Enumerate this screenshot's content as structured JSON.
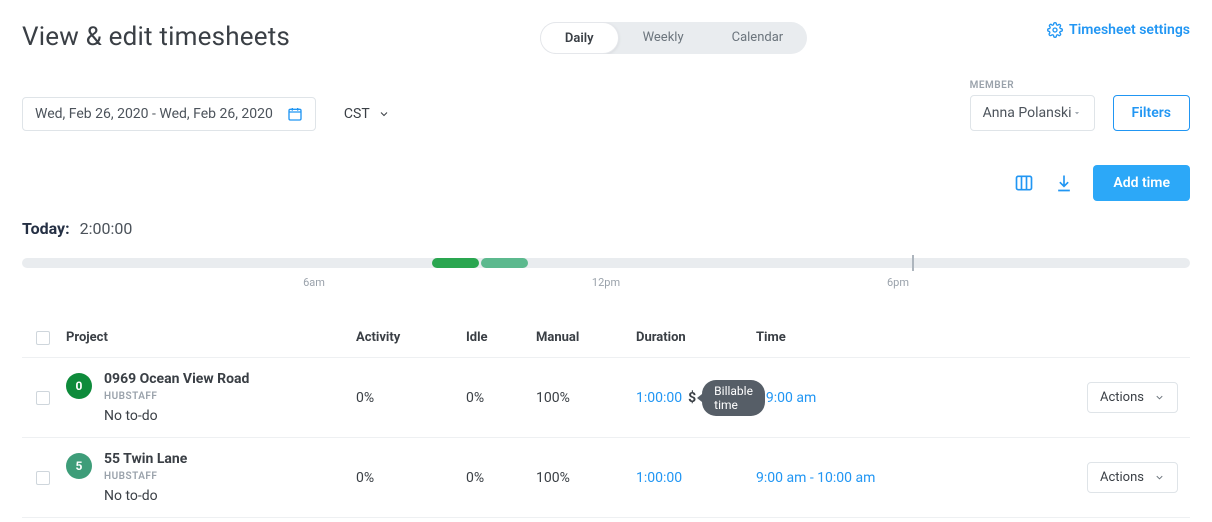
{
  "page_title": "View & edit timesheets",
  "view_tabs": {
    "daily": "Daily",
    "weekly": "Weekly",
    "calendar": "Calendar"
  },
  "settings_link": "Timesheet settings",
  "date_range": "Wed, Feb 26, 2020 - Wed, Feb 26, 2020",
  "timezone": "CST",
  "member_label": "MEMBER",
  "member_value": "Anna Polanski",
  "filters_label": "Filters",
  "add_time_label": "Add time",
  "today_label": "Today:",
  "today_value": "2:00:00",
  "timeline": {
    "ticks": [
      {
        "label": "6am",
        "pct": 25
      },
      {
        "label": "12pm",
        "pct": 50
      },
      {
        "label": "6pm",
        "pct": 75
      }
    ],
    "now_marker_pct": 76.2,
    "segments": [
      {
        "left_pct": 35.1,
        "width_pct": 4.0,
        "color": "#2aa650"
      },
      {
        "left_pct": 39.3,
        "width_pct": 4.0,
        "color": "#5cb98e"
      }
    ]
  },
  "columns": {
    "project": "Project",
    "activity": "Activity",
    "idle": "Idle",
    "manual": "Manual",
    "duration": "Duration",
    "time": "Time"
  },
  "tooltip_billable": "Billable time",
  "actions_label": "Actions",
  "rows": [
    {
      "badge_text": "0",
      "badge_color": "#0e8b3b",
      "name": "0969 Ocean View Road",
      "org": "HUBSTAFF",
      "todo": "No to-do",
      "activity": "0%",
      "idle": "0%",
      "manual": "100%",
      "duration": "1:00:00",
      "show_dollar": true,
      "show_tooltip": true,
      "time_overlapped": "00 am - 9:00 am",
      "time": "8:00 am - 9:00 am"
    },
    {
      "badge_text": "5",
      "badge_color": "#3e9d79",
      "name": "55 Twin Lane",
      "org": "HUBSTAFF",
      "todo": "No to-do",
      "activity": "0%",
      "idle": "0%",
      "manual": "100%",
      "duration": "1:00:00",
      "show_dollar": false,
      "show_tooltip": false,
      "time": "9:00 am - 10:00 am"
    }
  ]
}
